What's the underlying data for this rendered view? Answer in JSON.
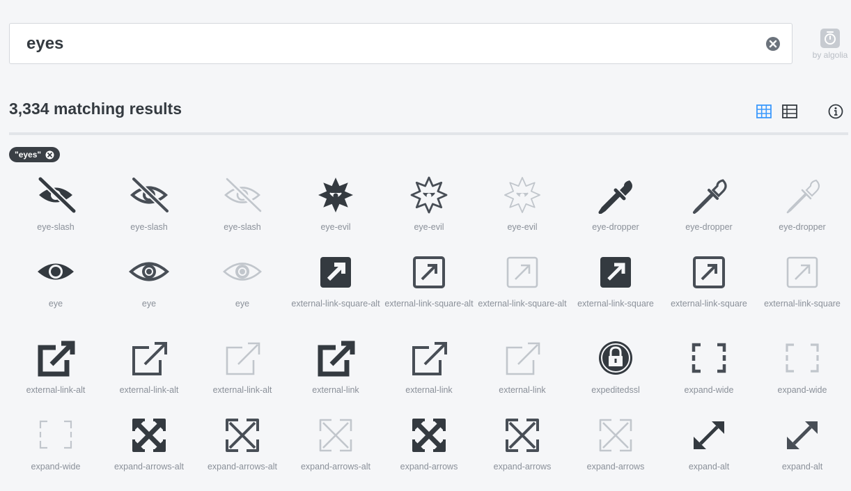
{
  "search": {
    "value": "eyes",
    "placeholder": ""
  },
  "algolia": {
    "label": "by algolia"
  },
  "results": {
    "count_text": "3,334 matching results"
  },
  "filter_tag": {
    "label": "\"eyes\""
  },
  "colors": {
    "solid": "#343a40",
    "regular": "#484e56",
    "light": "#c1c6cc",
    "accent": "#3b99fc"
  },
  "icons": [
    {
      "name": "eye-slash",
      "style": "solid"
    },
    {
      "name": "eye-slash",
      "style": "regular"
    },
    {
      "name": "eye-slash",
      "style": "light"
    },
    {
      "name": "eye-evil",
      "style": "solid"
    },
    {
      "name": "eye-evil",
      "style": "regular"
    },
    {
      "name": "eye-evil",
      "style": "light"
    },
    {
      "name": "eye-dropper",
      "style": "solid"
    },
    {
      "name": "eye-dropper",
      "style": "regular"
    },
    {
      "name": "eye-dropper",
      "style": "light"
    },
    {
      "name": "eye",
      "style": "solid"
    },
    {
      "name": "eye",
      "style": "regular"
    },
    {
      "name": "eye",
      "style": "light"
    },
    {
      "name": "external-link-square-alt",
      "style": "solid"
    },
    {
      "name": "external-link-square-alt",
      "style": "regular"
    },
    {
      "name": "external-link-square-alt",
      "style": "light"
    },
    {
      "name": "external-link-square",
      "style": "solid"
    },
    {
      "name": "external-link-square",
      "style": "regular"
    },
    {
      "name": "external-link-square",
      "style": "light"
    },
    {
      "name": "external-link-alt",
      "style": "solid"
    },
    {
      "name": "external-link-alt",
      "style": "regular"
    },
    {
      "name": "external-link-alt",
      "style": "light"
    },
    {
      "name": "external-link",
      "style": "solid"
    },
    {
      "name": "external-link",
      "style": "regular"
    },
    {
      "name": "external-link",
      "style": "light"
    },
    {
      "name": "expeditedssl",
      "style": "brand"
    },
    {
      "name": "expand-wide",
      "style": "regular"
    },
    {
      "name": "expand-wide",
      "style": "light"
    },
    {
      "name": "expand-wide",
      "style": "thin"
    },
    {
      "name": "expand-arrows-alt",
      "style": "solid"
    },
    {
      "name": "expand-arrows-alt",
      "style": "regular"
    },
    {
      "name": "expand-arrows-alt",
      "style": "light"
    },
    {
      "name": "expand-arrows",
      "style": "solid"
    },
    {
      "name": "expand-arrows",
      "style": "regular"
    },
    {
      "name": "expand-arrows",
      "style": "light"
    },
    {
      "name": "expand-alt",
      "style": "solid"
    },
    {
      "name": "expand-alt",
      "style": "regular"
    }
  ]
}
